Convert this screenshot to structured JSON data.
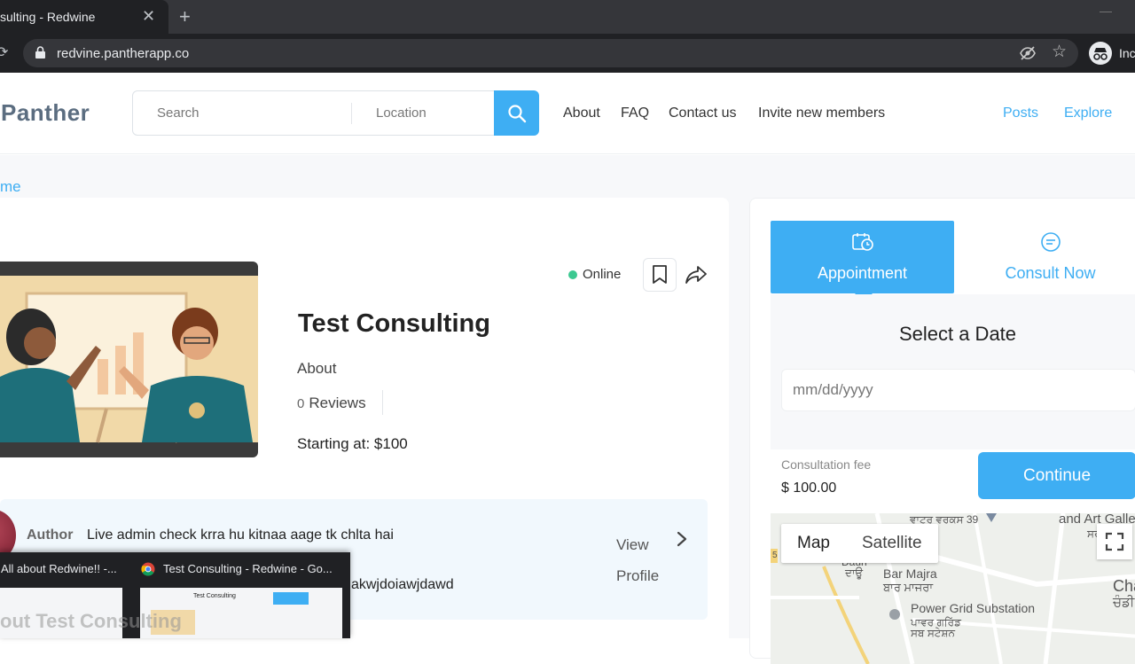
{
  "browser": {
    "tab_title": "sulting - Redwine",
    "tab_close": "✕",
    "new_tab": "+",
    "url": "redvine.pantherapp.co",
    "incognito_label": "Inc"
  },
  "header": {
    "logo": "Panther",
    "search_placeholder": "Search",
    "location_placeholder": "Location",
    "nav": [
      "About",
      "FAQ",
      "Contact us",
      "Invite new members"
    ],
    "nav_right": [
      "Posts",
      "Explore"
    ]
  },
  "breadcrumb": "me",
  "business": {
    "status": "Online",
    "title": "Test Consulting",
    "about_label": "About",
    "review_count": "0",
    "reviews_label": "Reviews",
    "starting_at": "Starting at: $100"
  },
  "author": {
    "label": "Author",
    "text_line1": "Live admin check krra hu kitnaa aage tk chlta hai",
    "text_line2": "ioajwdioajwopdjpaowdjpoajwdpoajwdawd akwjdoiawjdawd",
    "view_profile_line1": "View",
    "view_profile_line2": "Profile"
  },
  "booking": {
    "tab_appointment": "Appointment",
    "tab_consult": "Consult Now",
    "select_date": "Select a Date",
    "date_placeholder": "mm/dd/yyyy",
    "fee_label": "Consultation fee",
    "fee_value": "$ 100.00",
    "continue": "Continue"
  },
  "map": {
    "btn_map": "Map",
    "btn_satellite": "Satellite",
    "labels": [
      "ਵਾਟਰ ਵਰਕਸ 39",
      "and Art Galle",
      "ਸਰਕ",
      "Bar Majra",
      "ਬਾਰ ਮਾਜਰਾ",
      "Chan",
      "ਚੰਡੀ",
      "Power Grid Substation",
      "ਪਾਵਰ ਗਰਿੱਡ",
      "ਸਬ ਸਟੇਸ਼ਨ",
      "Daun",
      "ਦਾਊ",
      "5"
    ]
  },
  "taskbar": {
    "item1": "All about Redwine!! -...",
    "item2": "Test Consulting - Redwine - Go...",
    "overlay": "out Test Consulting"
  },
  "colors": {
    "accent": "#3eaef3",
    "online": "#3cc991",
    "logo_green": "#3ba58d"
  }
}
